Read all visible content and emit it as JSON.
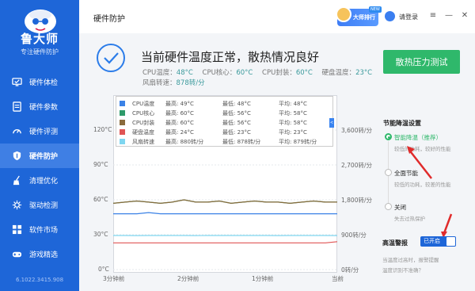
{
  "brand": {
    "name": "鲁大师",
    "tagline": "专注硬件防护",
    "version": "6.1022.3415.908"
  },
  "nav": [
    {
      "label": "硬件体检",
      "icon": "monitor-check-icon"
    },
    {
      "label": "硬件参数",
      "icon": "hardware-params-icon"
    },
    {
      "label": "硬件评测",
      "icon": "benchmark-icon"
    },
    {
      "label": "硬件防护",
      "icon": "shield-icon",
      "active": true
    },
    {
      "label": "清理优化",
      "icon": "broom-icon"
    },
    {
      "label": "驱动检测",
      "icon": "driver-icon"
    },
    {
      "label": "软件市场",
      "icon": "app-market-icon"
    },
    {
      "label": "游戏精选",
      "icon": "game-icon"
    }
  ],
  "topbar": {
    "title": "硬件防护",
    "badge": "大师排行",
    "badge_new": "NEW",
    "login": "请登录",
    "menu_glyph": "≡",
    "minimize_glyph": "—",
    "close_glyph": "✕"
  },
  "status": {
    "title": "当前硬件温度正常，散热情况良好",
    "readings": [
      {
        "label": "CPU温度：",
        "value": "48°C"
      },
      {
        "label": "CPU核心：",
        "value": "60°C"
      },
      {
        "label": "CPU封装：",
        "value": "60°C"
      },
      {
        "label": "硬盘温度：",
        "value": "23°C"
      }
    ],
    "fan": {
      "label": "风扇转速：",
      "value": "878转/分"
    },
    "stress_button": "散热压力测试"
  },
  "legend": {
    "tab": "<",
    "rows": [
      {
        "name": "CPU温度",
        "max": "最高: 49°C",
        "min": "最低: 48°C",
        "avg": "平均: 48°C",
        "color": "#3b82e6"
      },
      {
        "name": "CPU核心",
        "max": "最高: 60°C",
        "min": "最低: 56°C",
        "avg": "平均: 58°C",
        "color": "#2e9a6a"
      },
      {
        "name": "CPU封装",
        "max": "最高: 60°C",
        "min": "最低: 56°C",
        "avg": "平均: 58°C",
        "color": "#8a6b3c"
      },
      {
        "name": "硬盘温度",
        "max": "最高: 24°C",
        "min": "最低: 23°C",
        "avg": "平均: 23°C",
        "color": "#e05454"
      },
      {
        "name": "风扇转速",
        "max": "最高: 880转/分",
        "min": "最低: 878转/分",
        "avg": "平均: 879转/分",
        "color": "#7fd6f0"
      }
    ]
  },
  "chart_data": {
    "type": "line",
    "x_ticks": [
      "3分钟前",
      "2分钟前",
      "1分钟前",
      "当前"
    ],
    "y_left_ticks": [
      "0°C",
      "30°C",
      "60°C",
      "90°C",
      "120°C"
    ],
    "y_left_range": [
      0,
      120
    ],
    "y_right_ticks": [
      "0转/分",
      "900转/分",
      "1,800转/分",
      "2,700转/分",
      "3,600转/分"
    ],
    "y_right_range": [
      0,
      3600
    ],
    "grid": true,
    "series": [
      {
        "name": "CPU温度",
        "axis": "left",
        "color": "#3b82e6",
        "values": [
          48,
          48,
          48,
          49,
          48,
          48,
          48,
          48,
          48,
          48,
          48,
          48,
          48,
          48,
          48,
          48,
          48,
          48,
          48,
          48
        ]
      },
      {
        "name": "CPU核心",
        "axis": "left",
        "color": "#2e9a6a",
        "values": [
          57,
          58,
          59,
          58,
          57,
          58,
          60,
          58,
          58,
          59,
          57,
          58,
          59,
          58,
          58,
          57,
          58,
          59,
          58,
          58
        ]
      },
      {
        "name": "CPU封装",
        "axis": "left",
        "color": "#8a6b3c",
        "values": [
          57,
          58,
          59,
          58,
          57,
          58,
          60,
          58,
          58,
          59,
          57,
          58,
          59,
          58,
          58,
          57,
          58,
          59,
          58,
          58
        ]
      },
      {
        "name": "硬盘温度",
        "axis": "left",
        "color": "#e05454",
        "values": [
          23,
          23,
          23,
          23,
          23,
          23,
          23,
          23,
          23,
          23,
          23,
          23,
          23,
          23,
          23,
          23,
          23,
          23,
          23,
          24
        ]
      },
      {
        "name": "风扇转速",
        "axis": "right",
        "color": "#7fd6f0",
        "values": [
          879,
          879,
          878,
          880,
          879,
          879,
          879,
          878,
          879,
          879,
          880,
          879,
          879,
          879,
          878,
          879,
          879,
          879,
          880,
          878
        ]
      }
    ]
  },
  "settings": {
    "title": "节能降温设置",
    "options": [
      {
        "label": "智能降温（推荐）",
        "desc": "较低的功耗，较好的性能",
        "selected": true
      },
      {
        "label": "全面节能",
        "desc": "较低的功耗，较差的性能",
        "selected": false
      },
      {
        "label": "关闭",
        "desc": "失去过热保护",
        "selected": false
      }
    ]
  },
  "alarm": {
    "label": "高温警报",
    "state": "已开启"
  },
  "hints": {
    "line1": "当温度过高时，报警提醒",
    "line2": "温度识别不准确？"
  }
}
